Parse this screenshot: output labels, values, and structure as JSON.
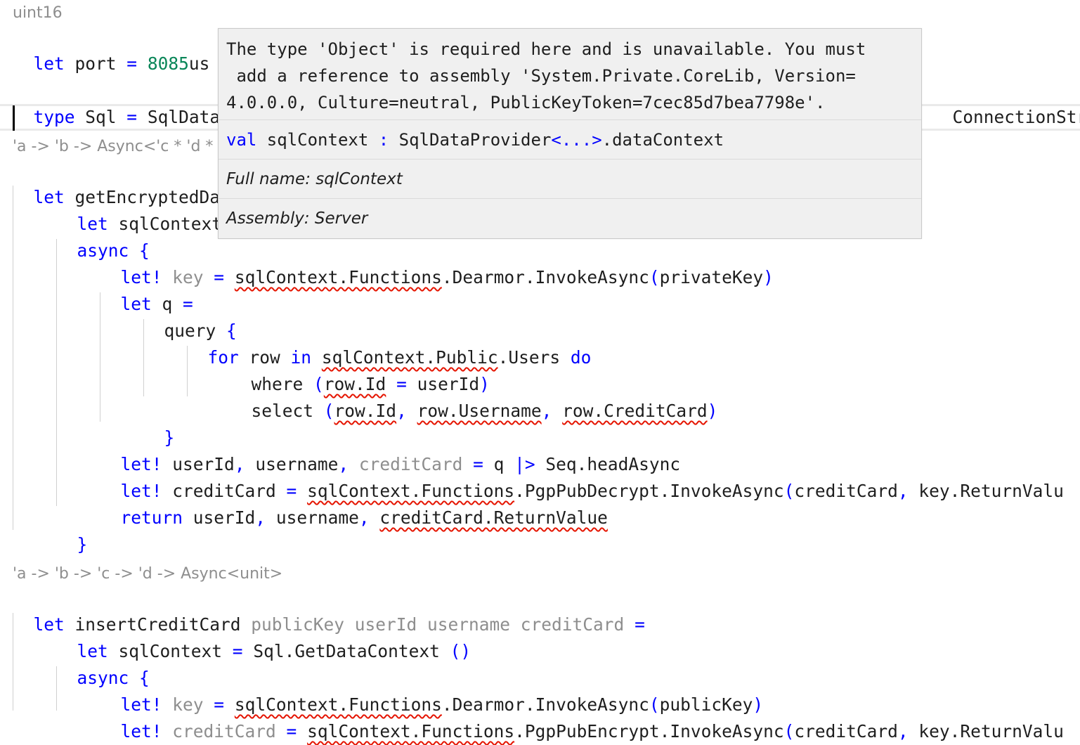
{
  "editor": {
    "lens_uint16": "uint16",
    "l1": {
      "kw": "let",
      "name": " port ",
      "eq": "=",
      "sp": " ",
      "num": "8085",
      "suffix": "us"
    },
    "l2": {
      "kw": "type",
      "text": " Sql ",
      "eq": "=",
      "rest": " SqlDataP",
      "tail": "ConnectionStri"
    },
    "lens_getenc": "'a -> 'b -> Async<'c * 'd *",
    "l3": {
      "kw": "let",
      "text": " getEncryptedDat"
    },
    "l4": {
      "kw": "let",
      "text": " sqlContext"
    },
    "l5": {
      "kw": "async",
      "brace": " {"
    },
    "l6": {
      "kw": "let!",
      "var": " key ",
      "eq": "=",
      "sp": " ",
      "err": "sqlContext.Functions",
      "rest": ".Dearmor.InvokeAsync",
      "p1": "(",
      "arg": "privateKey",
      "p2": ")"
    },
    "l7": {
      "kw": "let",
      "text": " q ",
      "eq": "="
    },
    "l8": {
      "text": "query ",
      "brace": "{"
    },
    "l9": {
      "kw1": "for",
      "t1": " row ",
      "kw2": "in",
      "sp": " ",
      "err": "sqlContext.Public",
      "t2": ".Users ",
      "kw3": "do"
    },
    "l10": {
      "t1": "where ",
      "p1": "(",
      "err": "row.Id",
      "t2": " ",
      "eq": "=",
      "t3": " userId",
      "p2": ")"
    },
    "l11": {
      "t1": "select ",
      "p1": "(",
      "err1": "row.Id",
      "c1": ",",
      "sp1": " ",
      "err2": "row.Username",
      "c2": ",",
      "sp2": " ",
      "err3": "row.CreditCard",
      "p2": ")"
    },
    "l12": {
      "brace": "}"
    },
    "l13": {
      "kw": "let!",
      "t1": " userId",
      "c1": ",",
      "t2": " username",
      "c2": ",",
      "gray": " creditCard",
      "sp": " ",
      "eq": "=",
      "t3": " q ",
      "pipe": "|>",
      "t4": " Seq.headAsync"
    },
    "l14": {
      "kw": "let!",
      "t1": " creditCard ",
      "eq": "=",
      "sp": " ",
      "err": "sqlContext.Functions",
      "t2": ".PgpPubDecrypt.InvokeAsync",
      "p1": "(",
      "t3": "creditCard",
      "c1": ",",
      "t4": " key.ReturnValu"
    },
    "l15": {
      "kw": "return",
      "t1": " userId",
      "c1": ",",
      "t2": " username",
      "c2": ",",
      "sp": " ",
      "err": "creditCard.ReturnValue"
    },
    "l16": {
      "brace": "}"
    },
    "lens_insert": "'a -> 'b -> 'c -> 'd -> Async<unit>",
    "l17": {
      "kw": "let",
      "t1": " insertCreditCard ",
      "g": "publicKey userId username creditCard",
      "sp": " ",
      "eq": "="
    },
    "l18": {
      "kw": "let",
      "t1": " sqlContext ",
      "eq": "=",
      "t2": " Sql.GetDataContext ",
      "paren": "()"
    },
    "l19": {
      "kw": "async",
      "brace": " {"
    },
    "l20": {
      "kw": "let!",
      "var": " key ",
      "eq": "=",
      "sp": " ",
      "err": "sqlContext.Functions",
      "rest": ".Dearmor.InvokeAsync",
      "p1": "(",
      "arg": "publicKey",
      "p2": ")"
    },
    "l21": {
      "kw": "let!",
      "var": " creditCard ",
      "eq": "=",
      "sp": " ",
      "err": "sqlContext.Functions",
      "rest": ".PgpPubEncrypt.InvokeAsync",
      "p1": "(",
      "t3": "creditCard",
      "c1": ",",
      "t4": " key.ReturnValu"
    }
  },
  "tooltip": {
    "message_line1": "The type 'Object' is required here and is unavailable. You must",
    "message_line2": " add a reference to assembly 'System.Private.CoreLib, Version=",
    "message_line3": "4.0.0.0, Culture=neutral, PublicKeyToken=7cec85d7bea7798e'.",
    "sig_kw": "val",
    "sig_name": " sqlContext ",
    "sig_colon": ":",
    "sig_type": " SqlDataProvider",
    "sig_generic": "<...>",
    "sig_rest": ".dataContext",
    "full_name": "Full name: sqlContext",
    "assembly": "Assembly: Server"
  },
  "colors": {
    "keyword": "#0000ff",
    "number": "#098658",
    "inactive": "#8e8e8e",
    "error_squiggle": "#e51400",
    "tooltip_bg": "#f0f0f0"
  }
}
